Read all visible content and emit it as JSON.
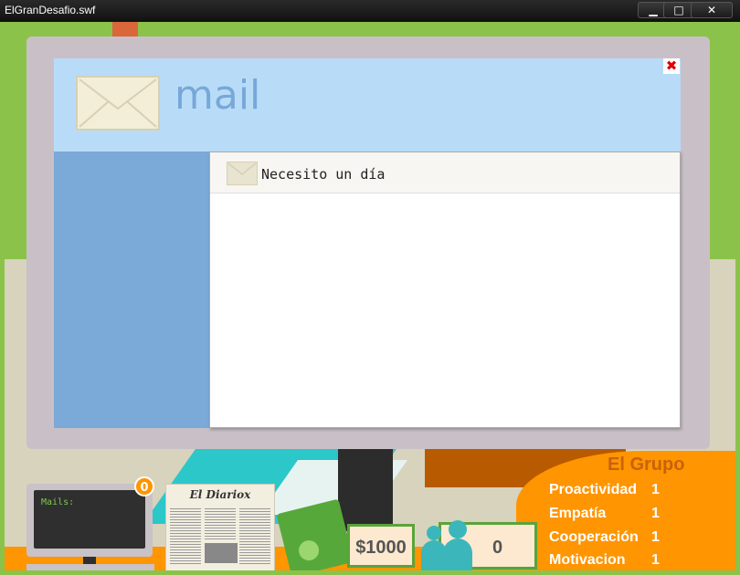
{
  "window": {
    "title": "ElGranDesafio.swf",
    "minimize_glyph": "▁",
    "maximize_glyph": "□",
    "close_glyph": "✕"
  },
  "mail_dialog": {
    "title": "mail",
    "close_glyph": "✖",
    "items": [
      {
        "subject": "Necesito un día",
        "icon": "envelope-icon"
      }
    ]
  },
  "hud": {
    "computer": {
      "label": "Mails:",
      "unread_count": "0"
    },
    "newspaper": {
      "title": "El Diariox"
    },
    "money": {
      "amount": "$1000"
    },
    "people": {
      "count": "0"
    },
    "group": {
      "title": "El Grupo",
      "stats": [
        {
          "name": "Proactividad",
          "value": "1"
        },
        {
          "name": "Empatía",
          "value": "1"
        },
        {
          "name": "Cooperación",
          "value": "1"
        },
        {
          "name": "Motivacion",
          "value": "1"
        }
      ]
    }
  },
  "colors": {
    "dialog_header": "#b8dcf8",
    "dialog_sidebar": "#7ba9d8",
    "accent_orange": "#ff9500",
    "money_green": "#5aa33c"
  }
}
